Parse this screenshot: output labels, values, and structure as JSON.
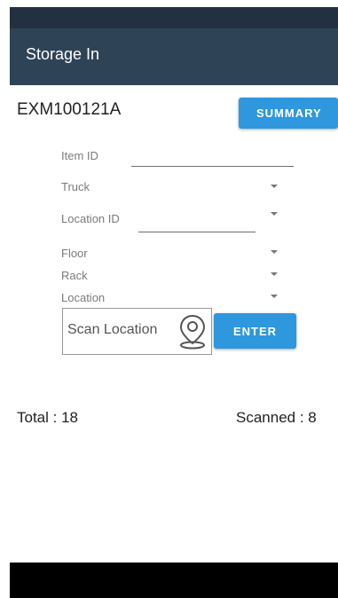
{
  "app_bar": {
    "title": "Storage In"
  },
  "header": {
    "document_id": "EXM100121A",
    "summary_label": "SUMMARY"
  },
  "form": {
    "item_id_label": "Item ID",
    "truck_label": "Truck",
    "location_id_label": "Location ID",
    "floor_label": "Floor",
    "rack_label": "Rack",
    "location_label": "Location",
    "scan_placeholder": "Scan Location",
    "enter_label": "ENTER"
  },
  "counts": {
    "total": "Total : 18",
    "scanned": "Scanned : 8"
  },
  "icons": {
    "scan": "location-pin-icon",
    "dropdown": "dropdown-arrow-icon"
  },
  "colors": {
    "status_bar": "#23303f",
    "app_bar": "#2f4357",
    "accent": "#2f97dd"
  }
}
